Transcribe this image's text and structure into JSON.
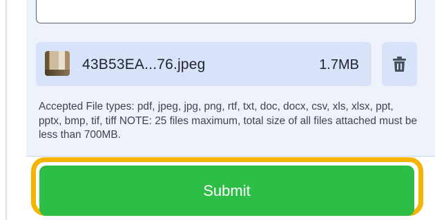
{
  "attachment": {
    "file_name": "43B53EA...76.jpeg",
    "file_size": "1.7MB"
  },
  "help_text": "Accepted File types: pdf, jpeg, jpg, png, rtf, txt, doc, docx, csv, xls, xlsx, ppt, pptx, bmp, tif, tiff NOTE: 25 files maximum, total size of all files attached must be less than 700MB.",
  "submit_label": "Submit",
  "icons": {
    "file_thumbnail": "image-thumbnail-icon",
    "delete": "trash-icon"
  },
  "colors": {
    "submit": "#2ebd47",
    "focus_ring": "#f5b400",
    "file_row": "#d8e2f8"
  }
}
